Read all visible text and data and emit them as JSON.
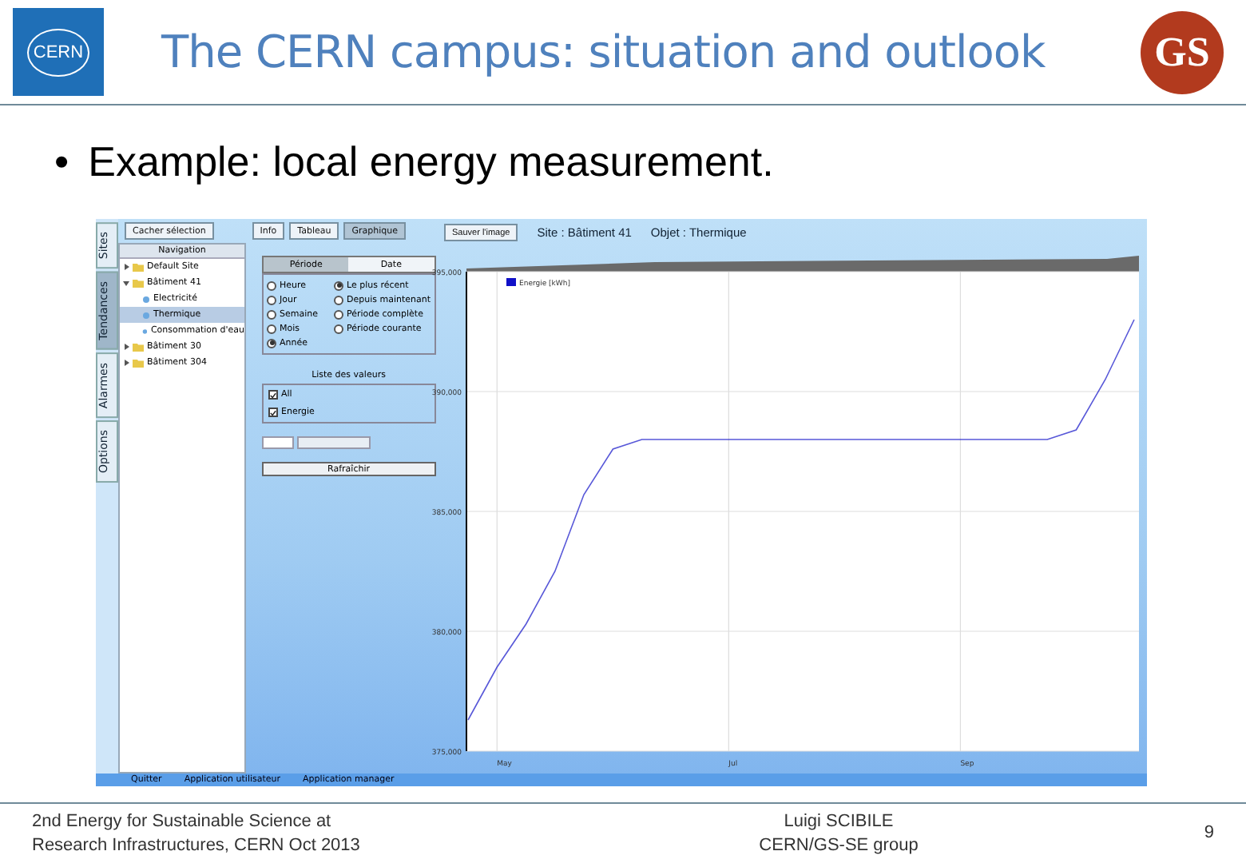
{
  "header": {
    "title": "The CERN campus: situation and outlook",
    "left_logo": "CERN",
    "right_logo": "GS"
  },
  "bullet": {
    "marker": "•",
    "text": "Example: local energy measurement."
  },
  "app": {
    "side_tabs": [
      {
        "label": "Sites",
        "selected": false
      },
      {
        "label": "Tendances",
        "selected": true
      },
      {
        "label": "Alarmes",
        "selected": false
      },
      {
        "label": "Options",
        "selected": false
      }
    ],
    "toolbar": {
      "hide_button": "Cacher sélection",
      "tabs": [
        {
          "label": "Info",
          "selected": false
        },
        {
          "label": "Tableau",
          "selected": false
        },
        {
          "label": "Graphique",
          "selected": true
        }
      ],
      "save_button": "Sauver l'image"
    },
    "navigation": {
      "title": "Navigation",
      "tree": [
        {
          "label": "Default Site",
          "expanded": false,
          "selected": false
        },
        {
          "label": "Bâtiment 41",
          "expanded": true,
          "selected": false,
          "children": [
            {
              "label": "Electricité",
              "selected": false
            },
            {
              "label": "Thermique",
              "selected": true
            },
            {
              "label": "Consommation d'eau",
              "selected": false
            }
          ]
        },
        {
          "label": "Bâtiment 30",
          "expanded": false,
          "selected": false
        },
        {
          "label": "Bâtiment 304",
          "expanded": false,
          "selected": false
        }
      ]
    },
    "period_tabs": [
      {
        "label": "Période",
        "selected": true
      },
      {
        "label": "Date",
        "selected": false
      }
    ],
    "periods": [
      {
        "label": "Heure",
        "selected": false
      },
      {
        "label": "Jour",
        "selected": false
      },
      {
        "label": "Semaine",
        "selected": false
      },
      {
        "label": "Mois",
        "selected": false
      },
      {
        "label": "Année",
        "selected": true
      }
    ],
    "ranges": [
      {
        "label": "Le plus récent",
        "selected": true
      },
      {
        "label": "Depuis maintenant",
        "selected": false
      },
      {
        "label": "Période complète",
        "selected": false
      },
      {
        "label": "Période courante",
        "selected": false
      }
    ],
    "values_title": "Liste des valeurs",
    "values": [
      {
        "label": "All",
        "checked": true
      },
      {
        "label": "Energie",
        "checked": true
      }
    ],
    "refresh_button": "Rafraîchir",
    "chart_title": {
      "site": "Site : Bâtiment 41",
      "object": "Objet : Thermique"
    },
    "chart": {
      "chart_data": {
        "type": "line",
        "grid": true,
        "ylim": [
          375000,
          395000
        ],
        "categories": [
          null,
          "May",
          null,
          null,
          null,
          null,
          null,
          null,
          null,
          "Jul",
          null,
          null,
          null,
          null,
          null,
          null,
          null,
          "Sep",
          null,
          null,
          null,
          null,
          null,
          null
        ],
        "yticks": [
          {
            "value": 375000,
            "label": "375,000"
          },
          {
            "value": 380000,
            "label": "380,000"
          },
          {
            "value": 385000,
            "label": "385,000"
          },
          {
            "value": 390000,
            "label": "390,000"
          },
          {
            "value": 395000,
            "label": "395,000"
          }
        ],
        "series": [
          {
            "name": "Energie [kWh]",
            "color": "#1010c8",
            "values": [
              376300,
              378500,
              380300,
              382500,
              385700,
              387600,
              388000,
              388000,
              388000,
              388000,
              388000,
              388000,
              388000,
              388000,
              388000,
              388000,
              388000,
              388000,
              388000,
              388000,
              388000,
              388400,
              390500,
              393000
            ]
          }
        ]
      }
    },
    "bottom_links": [
      "Quitter",
      "Application utilisateur",
      "Application manager"
    ]
  },
  "footer": {
    "event": "2nd Energy for Sustainable Science at\nResearch Infrastructures, CERN Oct 2013",
    "author": "Luigi SCIBILE\nCERN/GS-SE group",
    "page": "9"
  }
}
